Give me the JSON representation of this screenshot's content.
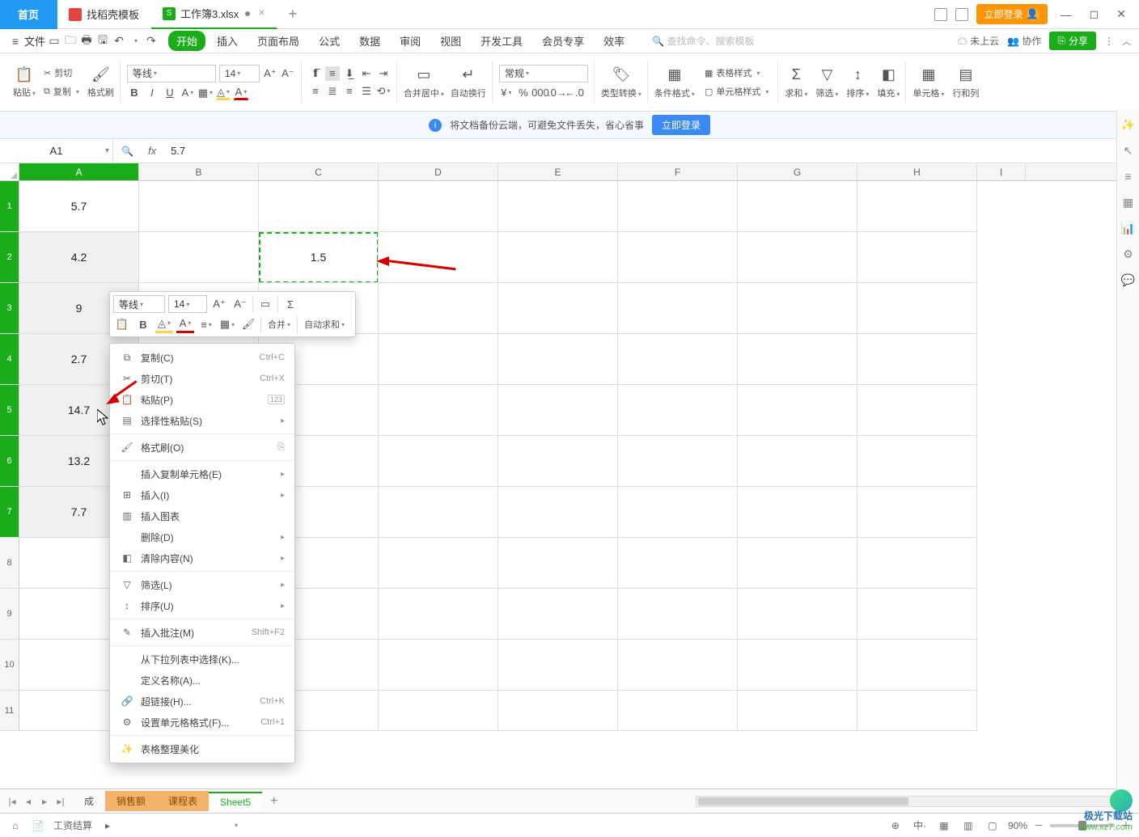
{
  "titlebar": {
    "home": "首页",
    "docker": "找稻壳模板",
    "workbook": "工作簿3.xlsx",
    "login": "立即登录"
  },
  "menubar": {
    "file": "文件",
    "items": [
      "开始",
      "插入",
      "页面布局",
      "公式",
      "数据",
      "审阅",
      "视图",
      "开发工具",
      "会员专享",
      "效率"
    ],
    "search_ph": "查找命令、搜索模板",
    "cloud": "未上云",
    "coop": "协作",
    "share": "分享"
  },
  "ribbon": {
    "paste": "粘贴",
    "cut": "剪切",
    "copy": "复制",
    "painter": "格式刷",
    "font_name": "等线",
    "font_size": "14",
    "merge": "合并居中",
    "wrap": "自动换行",
    "num_format": "常规",
    "type_conv": "类型转换",
    "cond_fmt": "条件格式",
    "table_style": "表格样式",
    "cell_style": "单元格样式",
    "sum": "求和",
    "filter": "筛选",
    "sort": "排序",
    "fill": "填充",
    "cell": "单元格",
    "rowcol": "行和列"
  },
  "banner": {
    "msg": "将文档备份云端，可避免文件丢失，省心省事",
    "login": "立即登录"
  },
  "namebox": "A1",
  "formula": "5.7",
  "columns": [
    "A",
    "B",
    "C",
    "D",
    "E",
    "F",
    "G",
    "H",
    "I"
  ],
  "row_labels": [
    "1",
    "2",
    "3",
    "4",
    "5",
    "6",
    "7",
    "8",
    "9",
    "10",
    "11"
  ],
  "cells": {
    "A1": "5.7",
    "A2": "4.2",
    "A3": "9",
    "A4": "2.7",
    "A5": "14.7",
    "A6": "13.2",
    "A7": "7.7",
    "C2": "1.5"
  },
  "minitb": {
    "font": "等线",
    "size": "14",
    "merge": "合并",
    "autosum": "自动求和"
  },
  "ctx": {
    "copy": "复制(C)",
    "copy_sc": "Ctrl+C",
    "cut": "剪切(T)",
    "cut_sc": "Ctrl+X",
    "paste": "粘贴(P)",
    "pastespec": "选择性粘贴(S)",
    "painter": "格式刷(O)",
    "insertcopy": "插入复制单元格(E)",
    "insert": "插入(I)",
    "insertchart": "插入图表",
    "delete": "删除(D)",
    "clear": "清除内容(N)",
    "filter": "筛选(L)",
    "sort": "排序(U)",
    "comment": "插入批注(M)",
    "comment_sc": "Shift+F2",
    "dropdown": "从下拉列表中选择(K)...",
    "defname": "定义名称(A)...",
    "hyperlink": "超链接(H)...",
    "hyperlink_sc": "Ctrl+K",
    "fmtcell": "设置单元格格式(F)...",
    "fmtcell_sc": "Ctrl+1",
    "tablebeauty": "表格整理美化"
  },
  "sheets": {
    "partial": "成",
    "sales": "销售额",
    "schedule": "课程表",
    "sheet5": "Sheet5"
  },
  "status": {
    "salary": "工资结算",
    "zoom": "90%"
  },
  "watermark": {
    "name": "极光下载站",
    "url": "www.xz7.com"
  }
}
